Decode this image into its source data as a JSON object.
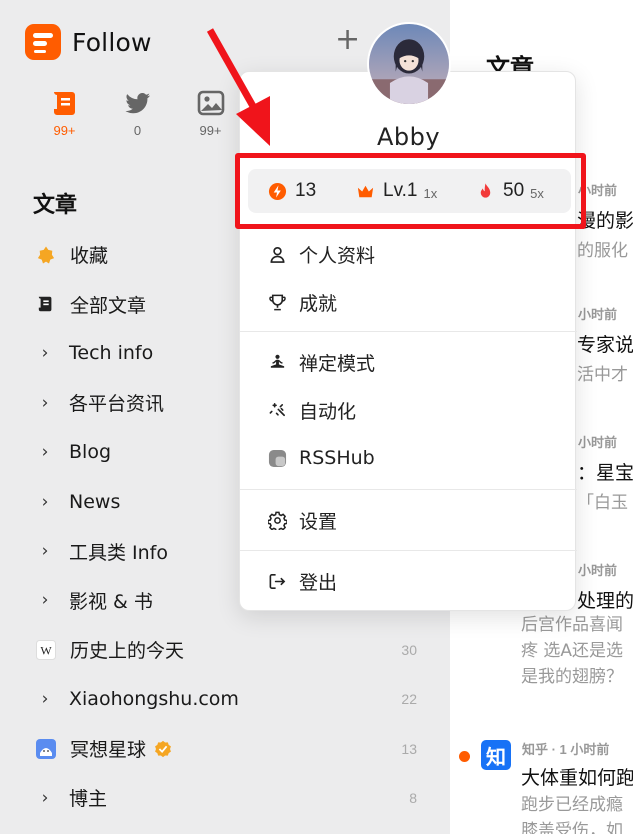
{
  "app": {
    "name": "Follow",
    "add_label": "+"
  },
  "categories": [
    {
      "icon": "article-icon",
      "count": "99+",
      "active": true
    },
    {
      "icon": "twitter-icon",
      "count": "0",
      "active": false
    },
    {
      "icon": "image-icon",
      "count": "99+",
      "active": false
    }
  ],
  "sidebar": {
    "section_title": "文章",
    "items": [
      {
        "label": "收藏",
        "icon": "star-icon",
        "chevron": false,
        "count": ""
      },
      {
        "label": "全部文章",
        "icon": "article-icon",
        "chevron": false,
        "count": ""
      },
      {
        "label": "Tech info",
        "chevron": true,
        "count": ""
      },
      {
        "label": "各平台资讯",
        "chevron": true,
        "count": ""
      },
      {
        "label": "Blog",
        "chevron": true,
        "count": ""
      },
      {
        "label": "News",
        "chevron": true,
        "count": ""
      },
      {
        "label": "工具类 Info",
        "chevron": true,
        "count": ""
      },
      {
        "label": "影视 & 书",
        "chevron": true,
        "count": ""
      },
      {
        "label": "历史上的今天",
        "icon": "wikipedia-icon",
        "chevron": false,
        "count": "30"
      },
      {
        "label": "Xiaohongshu.com",
        "chevron": true,
        "count": "22"
      },
      {
        "label": "冥想星球",
        "icon": "meditation-planet-icon",
        "chevron": false,
        "count": "13",
        "verified": true
      },
      {
        "label": "博主",
        "chevron": true,
        "count": "8"
      }
    ]
  },
  "content": {
    "title": "文章",
    "articles": [
      {
        "meta": "小时前",
        "title": "漫的影",
        "desc": "的服化"
      },
      {
        "meta": "小时前",
        "title": "专家说",
        "desc": "活中才"
      },
      {
        "meta": "小时前",
        "title": "：星宝",
        "desc": "「白玉"
      },
      {
        "meta": "小时前",
        "title": "处理的",
        "desc": ""
      }
    ],
    "prev_desc_lines": [
      "后宫作品喜闻",
      "疼 选A还是选",
      "是我的翅膀？"
    ],
    "feed_item": {
      "source": "知",
      "meta": "知乎 · 1 小时前",
      "title": "大体重如何跑",
      "desc_lines": [
        "跑步已经成瘾",
        "膝盖受伤，如"
      ]
    }
  },
  "profile_menu": {
    "username": "Abby",
    "stats": {
      "points": "13",
      "level": "Lv.1",
      "level_mult": "1x",
      "streak": "50",
      "streak_mult": "5x"
    },
    "items": [
      {
        "label": "个人资料",
        "icon": "user-icon"
      },
      {
        "label": "成就",
        "icon": "trophy-icon"
      },
      {
        "label": "禅定模式",
        "icon": "meditation-icon"
      },
      {
        "label": "自动化",
        "icon": "sparkle-icon"
      },
      {
        "label": "RSSHub",
        "icon": "rsshub-icon"
      },
      {
        "label": "设置",
        "icon": "gear-icon"
      },
      {
        "label": "登出",
        "icon": "logout-icon"
      }
    ]
  },
  "colors": {
    "accent": "#ff5c00",
    "annotation": "#f0141b",
    "sidebar_bg": "#ececed"
  }
}
